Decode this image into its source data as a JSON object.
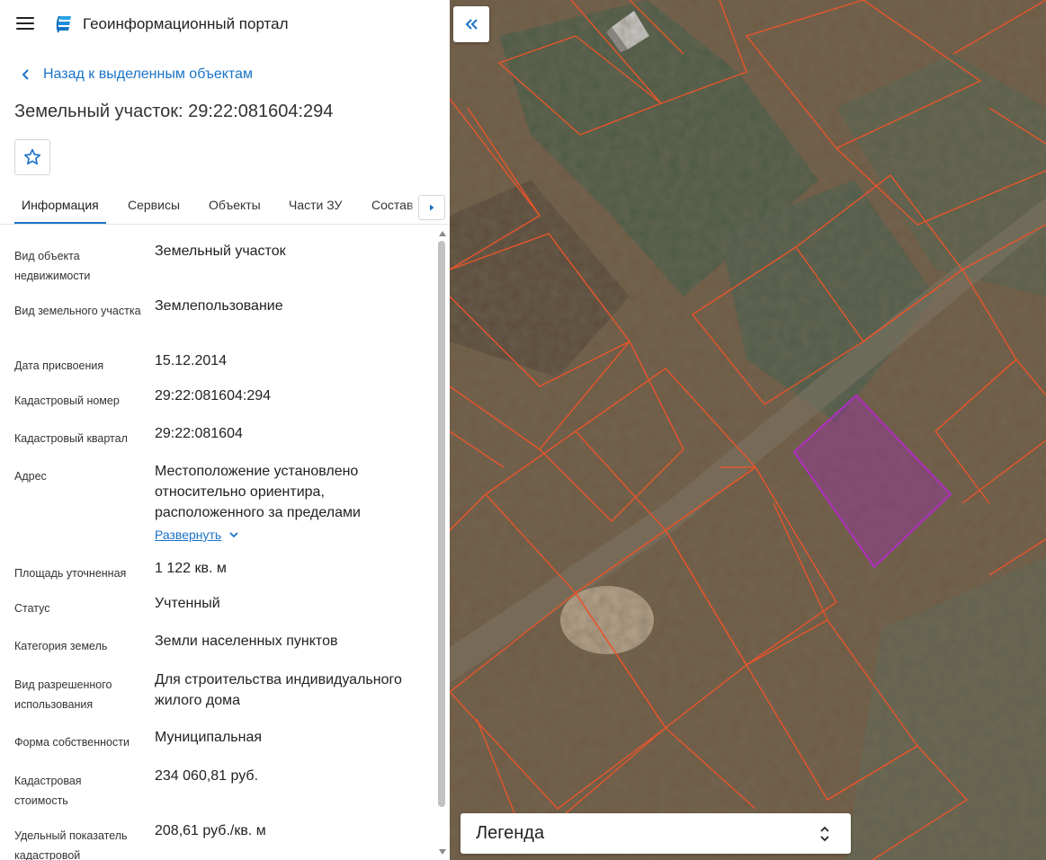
{
  "header": {
    "app_title": "Геоинформационный портал",
    "menu_icon": "hamburger-menu-icon",
    "logo_icon": "portal-logo-icon"
  },
  "navigation": {
    "back_label": "Назад к выделенным объектам"
  },
  "object": {
    "title": "Земельный участок: 29:22:081604:294",
    "favorite_icon": "star-outline-icon"
  },
  "tabs": [
    {
      "label": "Информация",
      "active": true
    },
    {
      "label": "Сервисы",
      "active": false
    },
    {
      "label": "Объекты",
      "active": false
    },
    {
      "label": "Части ЗУ",
      "active": false
    },
    {
      "label": "Состав",
      "active": false
    }
  ],
  "info": {
    "rows": [
      {
        "label": "Вид объекта недвижимости",
        "value": "Земельный участок"
      },
      {
        "label": "Вид земельного участка",
        "value": "Землепользование"
      },
      {
        "label": "Дата присвоения",
        "value": "15.12.2014"
      },
      {
        "label": "Кадастровый номер",
        "value": "29:22:081604:294"
      },
      {
        "label": "Кадастровый квартал",
        "value": "29:22:081604"
      },
      {
        "label": "Адрес",
        "value": "Местоположение установлено относительно ориентира, расположенного за пределами"
      },
      {
        "label": "Площадь уточненная",
        "value": "1 122 кв. м"
      },
      {
        "label": "Статус",
        "value": "Учтенный"
      },
      {
        "label": "Категория земель",
        "value": "Земли населенных пунктов"
      },
      {
        "label": "Вид разрешенного использования",
        "value": "Для строительства индивидуального жилого дома"
      },
      {
        "label": "Форма собственности",
        "value": "Муниципальная"
      },
      {
        "label": "Кадастровая стоимость",
        "value": "234 060,81 руб."
      },
      {
        "label": "Удельный показатель кадастровой",
        "value": "208,61 руб./кв. м"
      }
    ],
    "expand_label": "Развернуть"
  },
  "map": {
    "legend_label": "Легенда",
    "parcel_outline_color": "#e8552a",
    "selected_parcel_color": "#a02ab0"
  }
}
